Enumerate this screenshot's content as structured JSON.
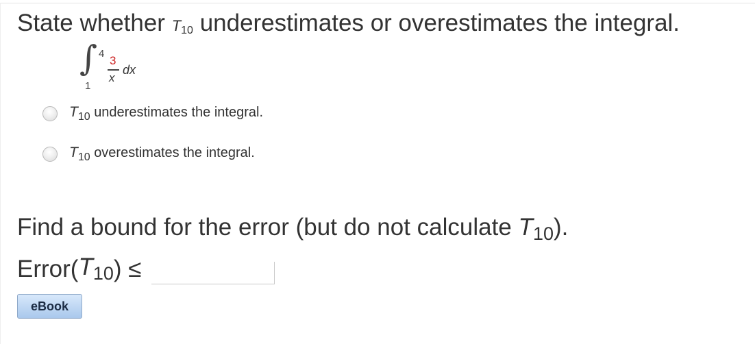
{
  "question": {
    "prefix": "State whether",
    "t_symbol": "T",
    "t_subscript": "10",
    "suffix": "underestimates or overestimates the integral."
  },
  "integral": {
    "sign": "∫",
    "upper_limit": "4",
    "lower_limit": "1",
    "numerator": "3",
    "denominator": "x",
    "differential": "dx"
  },
  "options": [
    {
      "t_symbol": "T",
      "t_subscript": "10",
      "label": "underestimates the integral.",
      "selected": false
    },
    {
      "t_symbol": "T",
      "t_subscript": "10",
      "label": "overestimates the integral.",
      "selected": false
    }
  ],
  "bound_question": {
    "prefix": "Find a bound for the error (but do not calculate",
    "t_symbol": "T",
    "t_subscript": "10",
    "suffix": ")."
  },
  "error_line": {
    "prefix": "Error(",
    "t_symbol": "T",
    "t_subscript": "10",
    "suffix": ") ≤",
    "input_value": "",
    "input_placeholder": ""
  },
  "ebook_button": {
    "label": "eBook"
  },
  "colors": {
    "text": "#333333",
    "numerator_red": "#cc2222",
    "button_gradient_top": "#d8e8fb",
    "button_gradient_bottom": "#a9c8ec"
  }
}
